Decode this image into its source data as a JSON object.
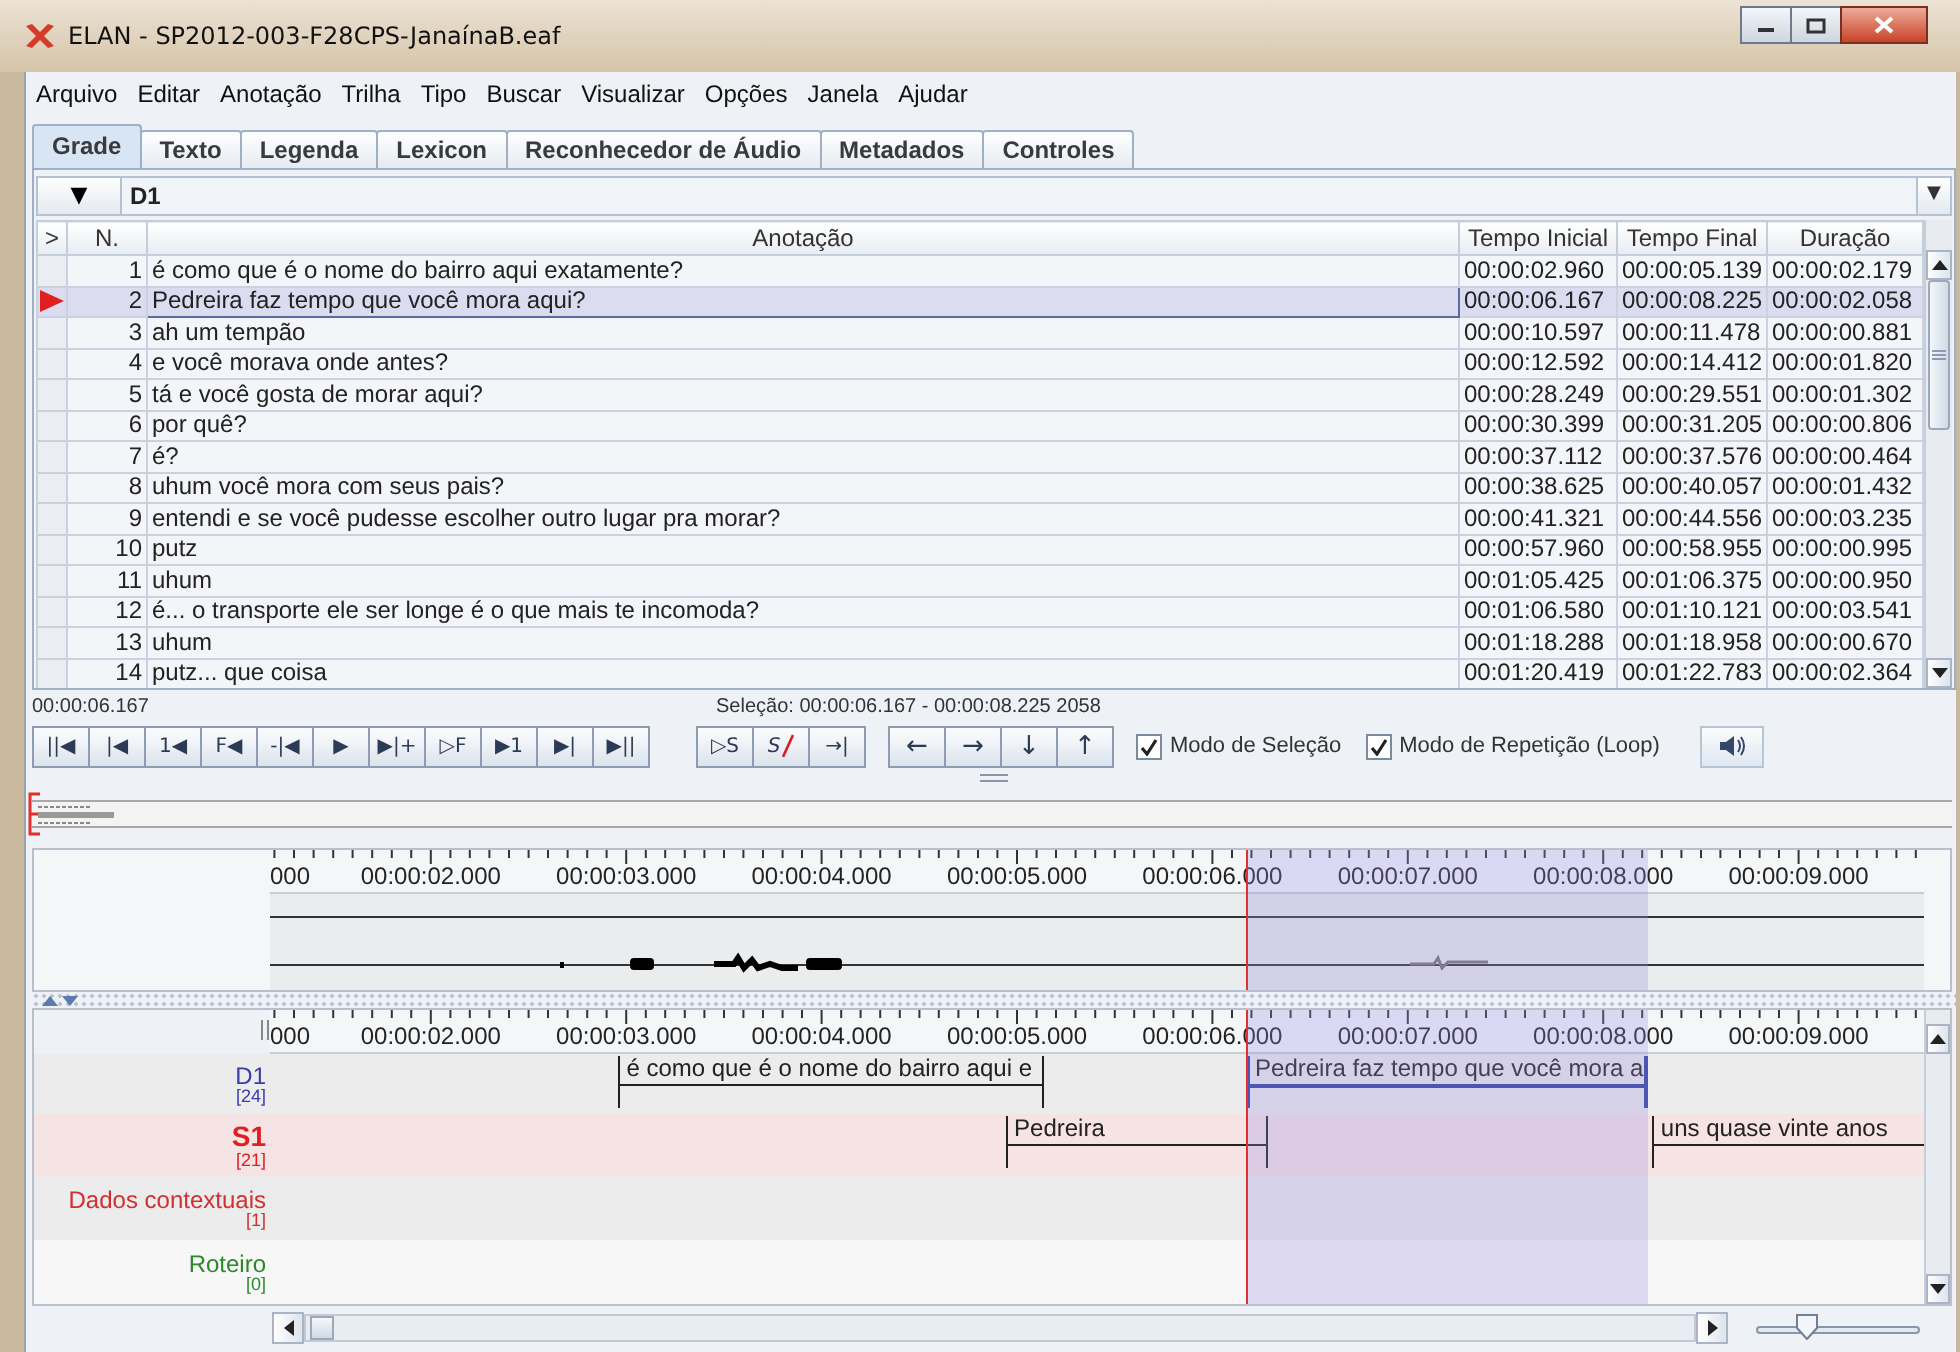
{
  "window": {
    "title": "ELAN - SP2012-003-F28CPS-JanaínaB.eaf"
  },
  "menu": [
    "Arquivo",
    "Editar",
    "Anotação",
    "Trilha",
    "Tipo",
    "Buscar",
    "Visualizar",
    "Opções",
    "Janela",
    "Ajudar"
  ],
  "tabs": [
    {
      "label": "Grade",
      "selected": true
    },
    {
      "label": "Texto",
      "selected": false
    },
    {
      "label": "Legenda",
      "selected": false
    },
    {
      "label": "Lexicon",
      "selected": false
    },
    {
      "label": "Reconhecedor de Áudio",
      "selected": false
    },
    {
      "label": "Metadados",
      "selected": false
    },
    {
      "label": "Controles",
      "selected": false
    }
  ],
  "tier_selector": {
    "button": "▼",
    "value": "D1",
    "arrow": "▼"
  },
  "table": {
    "columns": [
      ">",
      "N.",
      "Anotação",
      "Tempo Inicial",
      "Tempo Final",
      "Duração"
    ],
    "rows": [
      {
        "n": "1",
        "text": "é como que é o nome do bairro aqui exatamente?",
        "start": "00:00:02.960",
        "end": "00:00:05.139",
        "duration": "00:00:02.179",
        "selected": false
      },
      {
        "n": "2",
        "text": "Pedreira faz tempo que você mora aqui?",
        "start": "00:00:06.167",
        "end": "00:00:08.225",
        "duration": "00:00:02.058",
        "selected": true
      },
      {
        "n": "3",
        "text": "ah um tempão",
        "start": "00:00:10.597",
        "end": "00:00:11.478",
        "duration": "00:00:00.881",
        "selected": false
      },
      {
        "n": "4",
        "text": "e você morava onde antes?",
        "start": "00:00:12.592",
        "end": "00:00:14.412",
        "duration": "00:00:01.820",
        "selected": false
      },
      {
        "n": "5",
        "text": "tá e você gosta de morar aqui?",
        "start": "00:00:28.249",
        "end": "00:00:29.551",
        "duration": "00:00:01.302",
        "selected": false
      },
      {
        "n": "6",
        "text": "por quê?",
        "start": "00:00:30.399",
        "end": "00:00:31.205",
        "duration": "00:00:00.806",
        "selected": false
      },
      {
        "n": "7",
        "text": "é?",
        "start": "00:00:37.112",
        "end": "00:00:37.576",
        "duration": "00:00:00.464",
        "selected": false
      },
      {
        "n": "8",
        "text": "uhum você mora com seus pais?",
        "start": "00:00:38.625",
        "end": "00:00:40.057",
        "duration": "00:00:01.432",
        "selected": false
      },
      {
        "n": "9",
        "text": "entendi e se você pudesse escolher outro lugar pra morar?",
        "start": "00:00:41.321",
        "end": "00:00:44.556",
        "duration": "00:00:03.235",
        "selected": false
      },
      {
        "n": "10",
        "text": "putz",
        "start": "00:00:57.960",
        "end": "00:00:58.955",
        "duration": "00:00:00.995",
        "selected": false
      },
      {
        "n": "11",
        "text": "uhum",
        "start": "00:01:05.425",
        "end": "00:01:06.375",
        "duration": "00:00:00.950",
        "selected": false
      },
      {
        "n": "12",
        "text": "é... o transporte ele ser longe é o que mais te incomoda?",
        "start": "00:01:06.580",
        "end": "00:01:10.121",
        "duration": "00:00:03.541",
        "selected": false
      },
      {
        "n": "13",
        "text": "uhum",
        "start": "00:01:18.288",
        "end": "00:01:18.958",
        "duration": "00:00:00.670",
        "selected": false
      },
      {
        "n": "14",
        "text": "putz... que coisa",
        "start": "00:01:20.419",
        "end": "00:01:22.783",
        "duration": "00:00:02.364",
        "selected": false
      }
    ]
  },
  "media_time": "00:00:06.167",
  "selection_info": "Seleção: 00:00:06.167 - 00:00:08.225  2058",
  "player_buttons": [
    "||◀",
    "|◀",
    "1◀",
    "F◀",
    "-|◀",
    "▶",
    "▶|+",
    "▷F",
    "▶1",
    "▶|",
    "▶||"
  ],
  "selection_buttons": [
    {
      "label": "▷S",
      "kind": "plain"
    },
    {
      "label": "S",
      "kind": "strike"
    },
    {
      "label": "→|",
      "kind": "plain"
    }
  ],
  "navigation_buttons": [
    "←",
    "→",
    "↓",
    "↑"
  ],
  "options": [
    {
      "label": "Modo de Seleção",
      "checked": true
    },
    {
      "label": "Modo de Repetição (Loop)",
      "checked": true
    }
  ],
  "waveform": {
    "ruler": [
      "000",
      "00:00:02.000",
      "00:00:03.000",
      "00:00:04.000",
      "00:00:05.000",
      "00:00:06.000",
      "00:00:07.000",
      "00:00:08.000",
      "00:00:09.000"
    ]
  },
  "timeline": {
    "ruler": [
      "000",
      "00:00:02.000",
      "00:00:03.000",
      "00:00:04.000",
      "00:00:05.000",
      "00:00:06.000",
      "00:00:07.000",
      "00:00:08.000",
      "00:00:09.000"
    ],
    "tiers": [
      {
        "name": "D1",
        "count": "[24]",
        "color": "#3b3bb0",
        "active": false,
        "annotations": [
          {
            "text": "é como que é o nome do bairro aqui e",
            "selected": false
          },
          {
            "text": "Pedreira faz tempo que você mora a",
            "selected": true
          }
        ]
      },
      {
        "name": "S1",
        "count": "[21]",
        "color": "#e02020",
        "active": true,
        "annotations": [
          {
            "text": "Pedreira",
            "selected": false
          },
          {
            "text": "uns quase vinte anos",
            "selected": false
          }
        ]
      },
      {
        "name": "Dados contextuais",
        "count": "[1]",
        "color": "#d03030",
        "active": false
      },
      {
        "name": "Roteiro",
        "count": "[0]",
        "color": "#2a8a2a",
        "active": false
      }
    ],
    "zoom": {
      "level": 0.3
    }
  }
}
